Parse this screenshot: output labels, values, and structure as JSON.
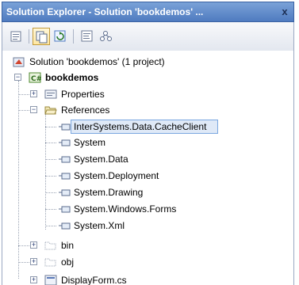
{
  "window": {
    "title": "Solution Explorer - Solution 'bookdemos' ...",
    "close_glyph": "x"
  },
  "toolbar": {
    "buttons": [
      {
        "icon": "properties-icon"
      },
      {
        "icon": "show-all-files-icon",
        "state": "active"
      },
      {
        "icon": "refresh-icon"
      },
      {
        "icon": "view-code-icon"
      },
      {
        "icon": "class-diagram-icon"
      }
    ]
  },
  "tree": {
    "solution": "Solution 'bookdemos' (1 project)",
    "project": "bookdemos",
    "properties": "Properties",
    "references": "References",
    "reference_items": [
      "InterSystems.Data.CacheClient",
      "System",
      "System.Data",
      "System.Deployment",
      "System.Drawing",
      "System.Windows.Forms",
      "System.Xml"
    ],
    "folders": [
      "bin",
      "obj"
    ],
    "partial_item": "DisplayForm.cs"
  },
  "colors": {
    "titlebar": "#4f7bc0",
    "selection": "#dfe9f7",
    "selection_border": "#7aa7e0"
  }
}
